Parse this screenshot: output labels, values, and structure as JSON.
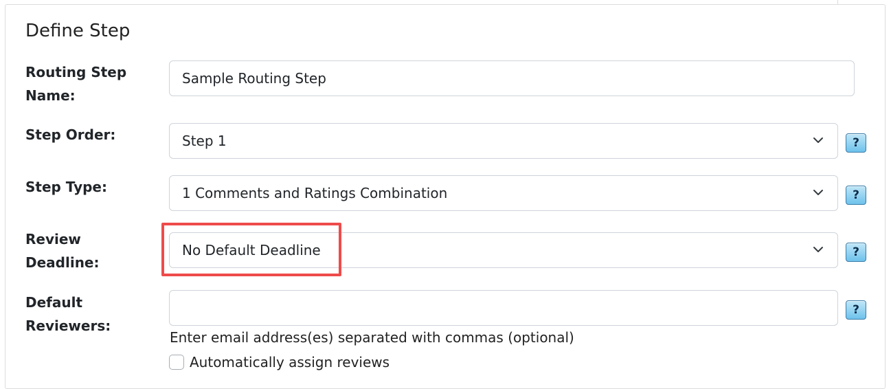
{
  "section": {
    "title": "Define Step"
  },
  "routing_step_name": {
    "label_line1": "Routing Step",
    "label_line2": "Name:",
    "value": "Sample Routing Step"
  },
  "step_order": {
    "label": "Step Order:",
    "selected": "Step 1",
    "help": "?"
  },
  "step_type": {
    "label": "Step Type:",
    "selected": "1 Comments and Ratings Combination",
    "help": "?"
  },
  "review_deadline": {
    "label_line1": "Review",
    "label_line2": "Deadline:",
    "selected": "No Default Deadline",
    "help": "?"
  },
  "default_reviewers": {
    "label_line1": "Default",
    "label_line2": "Reviewers:",
    "value": "",
    "help": "?",
    "hint": "Enter email address(es) separated with commas (optional)",
    "auto_assign_label": "Automatically assign reviews",
    "auto_assign_checked": false
  },
  "colors": {
    "highlight": "#ef4b4b",
    "help_button": "#6ec2ec",
    "field_border": "#ced4da"
  },
  "icons": {
    "dropdown": "chevron-down-icon",
    "help": "question-mark-icon"
  }
}
